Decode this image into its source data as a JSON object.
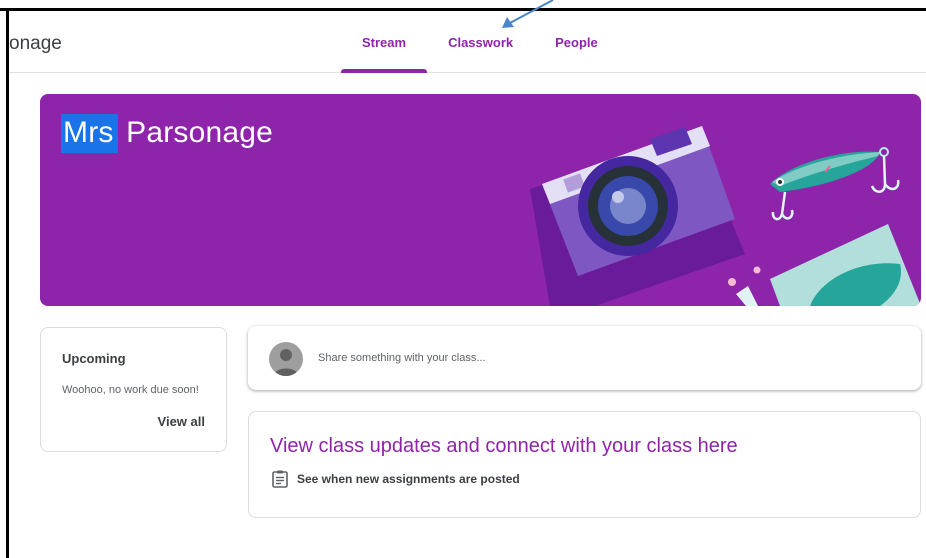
{
  "header": {
    "title": "onage",
    "tabs": [
      {
        "label": "Stream",
        "active": true
      },
      {
        "label": "Classwork",
        "active": false
      },
      {
        "label": "People",
        "active": false
      }
    ]
  },
  "banner": {
    "title_highlight": "Mrs",
    "title_rest": " Parsonage",
    "color": "#8e24aa",
    "highlight_color": "#1a73e8"
  },
  "upcoming": {
    "title": "Upcoming",
    "message": "Woohoo, no work due soon!",
    "link": "View all"
  },
  "share": {
    "placeholder": "Share something with your class..."
  },
  "updates": {
    "title": "View class updates and connect with your class here",
    "hint": "See when new assignments are posted",
    "hint_icon": "assignment-icon"
  },
  "annotation": {
    "arrow_color": "#4a86c8"
  }
}
